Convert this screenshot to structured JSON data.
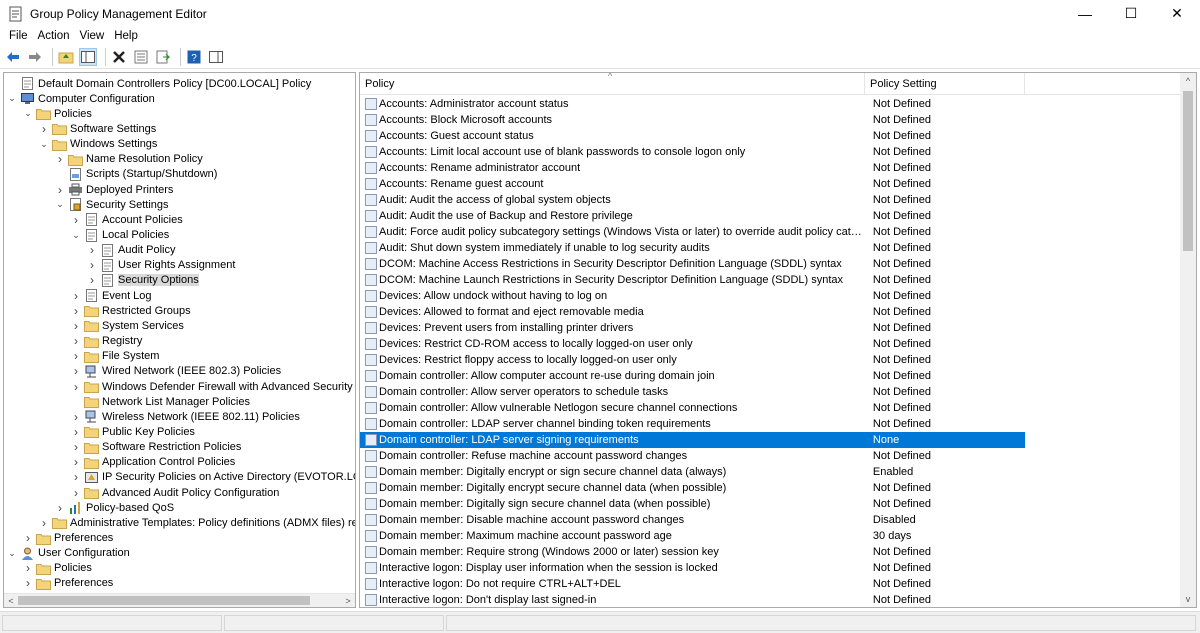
{
  "window": {
    "title": "Group Policy Management Editor",
    "minimize": "—",
    "maximize": "☐",
    "close": "✕"
  },
  "menu": [
    "File",
    "Action",
    "View",
    "Help"
  ],
  "tree": [
    {
      "label": "Default Domain Controllers Policy [DC00.LOCAL] Policy",
      "level": 0,
      "exp": "",
      "icon": "policy"
    },
    {
      "label": "Computer Configuration",
      "level": 0,
      "exp": "v",
      "icon": "computer"
    },
    {
      "label": "Policies",
      "level": 1,
      "exp": "v",
      "icon": "folder"
    },
    {
      "label": "Software Settings",
      "level": 2,
      "exp": ">",
      "icon": "folder"
    },
    {
      "label": "Windows Settings",
      "level": 2,
      "exp": "v",
      "icon": "folder"
    },
    {
      "label": "Name Resolution Policy",
      "level": 3,
      "exp": ">",
      "icon": "folder"
    },
    {
      "label": "Scripts (Startup/Shutdown)",
      "level": 3,
      "exp": "",
      "icon": "script"
    },
    {
      "label": "Deployed Printers",
      "level": 3,
      "exp": ">",
      "icon": "printer"
    },
    {
      "label": "Security Settings",
      "level": 3,
      "exp": "v",
      "icon": "security"
    },
    {
      "label": "Account Policies",
      "level": 4,
      "exp": ">",
      "icon": "policy"
    },
    {
      "label": "Local Policies",
      "level": 4,
      "exp": "v",
      "icon": "policy"
    },
    {
      "label": "Audit Policy",
      "level": 5,
      "exp": ">",
      "icon": "policy"
    },
    {
      "label": "User Rights Assignment",
      "level": 5,
      "exp": ">",
      "icon": "policy"
    },
    {
      "label": "Security Options",
      "level": 5,
      "exp": ">",
      "icon": "policy",
      "selected": true
    },
    {
      "label": "Event Log",
      "level": 4,
      "exp": ">",
      "icon": "policy"
    },
    {
      "label": "Restricted Groups",
      "level": 4,
      "exp": ">",
      "icon": "folder"
    },
    {
      "label": "System Services",
      "level": 4,
      "exp": ">",
      "icon": "folder"
    },
    {
      "label": "Registry",
      "level": 4,
      "exp": ">",
      "icon": "folder"
    },
    {
      "label": "File System",
      "level": 4,
      "exp": ">",
      "icon": "folder"
    },
    {
      "label": "Wired Network (IEEE 802.3) Policies",
      "level": 4,
      "exp": ">",
      "icon": "network"
    },
    {
      "label": "Windows Defender Firewall with Advanced Security",
      "level": 4,
      "exp": ">",
      "icon": "folder"
    },
    {
      "label": "Network List Manager Policies",
      "level": 4,
      "exp": "",
      "icon": "folder"
    },
    {
      "label": "Wireless Network (IEEE 802.11) Policies",
      "level": 4,
      "exp": ">",
      "icon": "network"
    },
    {
      "label": "Public Key Policies",
      "level": 4,
      "exp": ">",
      "icon": "folder"
    },
    {
      "label": "Software Restriction Policies",
      "level": 4,
      "exp": ">",
      "icon": "folder"
    },
    {
      "label": "Application Control Policies",
      "level": 4,
      "exp": ">",
      "icon": "folder"
    },
    {
      "label": "IP Security Policies on Active Directory (EVOTOR.LOCAL)",
      "level": 4,
      "exp": ">",
      "icon": "ipsec"
    },
    {
      "label": "Advanced Audit Policy Configuration",
      "level": 4,
      "exp": ">",
      "icon": "folder"
    },
    {
      "label": "Policy-based QoS",
      "level": 3,
      "exp": ">",
      "icon": "chart"
    },
    {
      "label": "Administrative Templates: Policy definitions (ADMX files) retrieved from the local computer",
      "level": 2,
      "exp": ">",
      "icon": "folder"
    },
    {
      "label": "Preferences",
      "level": 1,
      "exp": ">",
      "icon": "folder"
    },
    {
      "label": "User Configuration",
      "level": 0,
      "exp": "v",
      "icon": "user"
    },
    {
      "label": "Policies",
      "level": 1,
      "exp": ">",
      "icon": "folder"
    },
    {
      "label": "Preferences",
      "level": 1,
      "exp": ">",
      "icon": "folder"
    }
  ],
  "table": {
    "headers": [
      "Policy",
      "Policy Setting"
    ],
    "rows": [
      [
        "Accounts: Administrator account status",
        "Not Defined"
      ],
      [
        "Accounts: Block Microsoft accounts",
        "Not Defined"
      ],
      [
        "Accounts: Guest account status",
        "Not Defined"
      ],
      [
        "Accounts: Limit local account use of blank passwords to console logon only",
        "Not Defined"
      ],
      [
        "Accounts: Rename administrator account",
        "Not Defined"
      ],
      [
        "Accounts: Rename guest account",
        "Not Defined"
      ],
      [
        "Audit: Audit the access of global system objects",
        "Not Defined"
      ],
      [
        "Audit: Audit the use of Backup and Restore privilege",
        "Not Defined"
      ],
      [
        "Audit: Force audit policy subcategory settings (Windows Vista or later) to override audit policy category sett...",
        "Not Defined"
      ],
      [
        "Audit: Shut down system immediately if unable to log security audits",
        "Not Defined"
      ],
      [
        "DCOM: Machine Access Restrictions in Security Descriptor Definition Language (SDDL) syntax",
        "Not Defined"
      ],
      [
        "DCOM: Machine Launch Restrictions in Security Descriptor Definition Language (SDDL) syntax",
        "Not Defined"
      ],
      [
        "Devices: Allow undock without having to log on",
        "Not Defined"
      ],
      [
        "Devices: Allowed to format and eject removable media",
        "Not Defined"
      ],
      [
        "Devices: Prevent users from installing printer drivers",
        "Not Defined"
      ],
      [
        "Devices: Restrict CD-ROM access to locally logged-on user only",
        "Not Defined"
      ],
      [
        "Devices: Restrict floppy access to locally logged-on user only",
        "Not Defined"
      ],
      [
        "Domain controller: Allow computer account re-use during domain join",
        "Not Defined"
      ],
      [
        "Domain controller: Allow server operators to schedule tasks",
        "Not Defined"
      ],
      [
        "Domain controller: Allow vulnerable Netlogon secure channel connections",
        "Not Defined"
      ],
      [
        "Domain controller: LDAP server channel binding token requirements",
        "Not Defined"
      ],
      [
        "Domain controller: LDAP server signing requirements",
        "None"
      ],
      [
        "Domain controller: Refuse machine account password changes",
        "Not Defined"
      ],
      [
        "Domain member: Digitally encrypt or sign secure channel data (always)",
        "Enabled"
      ],
      [
        "Domain member: Digitally encrypt secure channel data (when possible)",
        "Not Defined"
      ],
      [
        "Domain member: Digitally sign secure channel data (when possible)",
        "Not Defined"
      ],
      [
        "Domain member: Disable machine account password changes",
        "Disabled"
      ],
      [
        "Domain member: Maximum machine account password age",
        "30 days"
      ],
      [
        "Domain member: Require strong (Windows 2000 or later) session key",
        "Not Defined"
      ],
      [
        "Interactive logon: Display user information when the session is locked",
        "Not Defined"
      ],
      [
        "Interactive logon: Do not require CTRL+ALT+DEL",
        "Not Defined"
      ],
      [
        "Interactive logon: Don't display last signed-in",
        "Not Defined"
      ]
    ],
    "selected_row": 21
  },
  "colors": {
    "selection": "#0078d7",
    "folder": "#f4d47a"
  }
}
